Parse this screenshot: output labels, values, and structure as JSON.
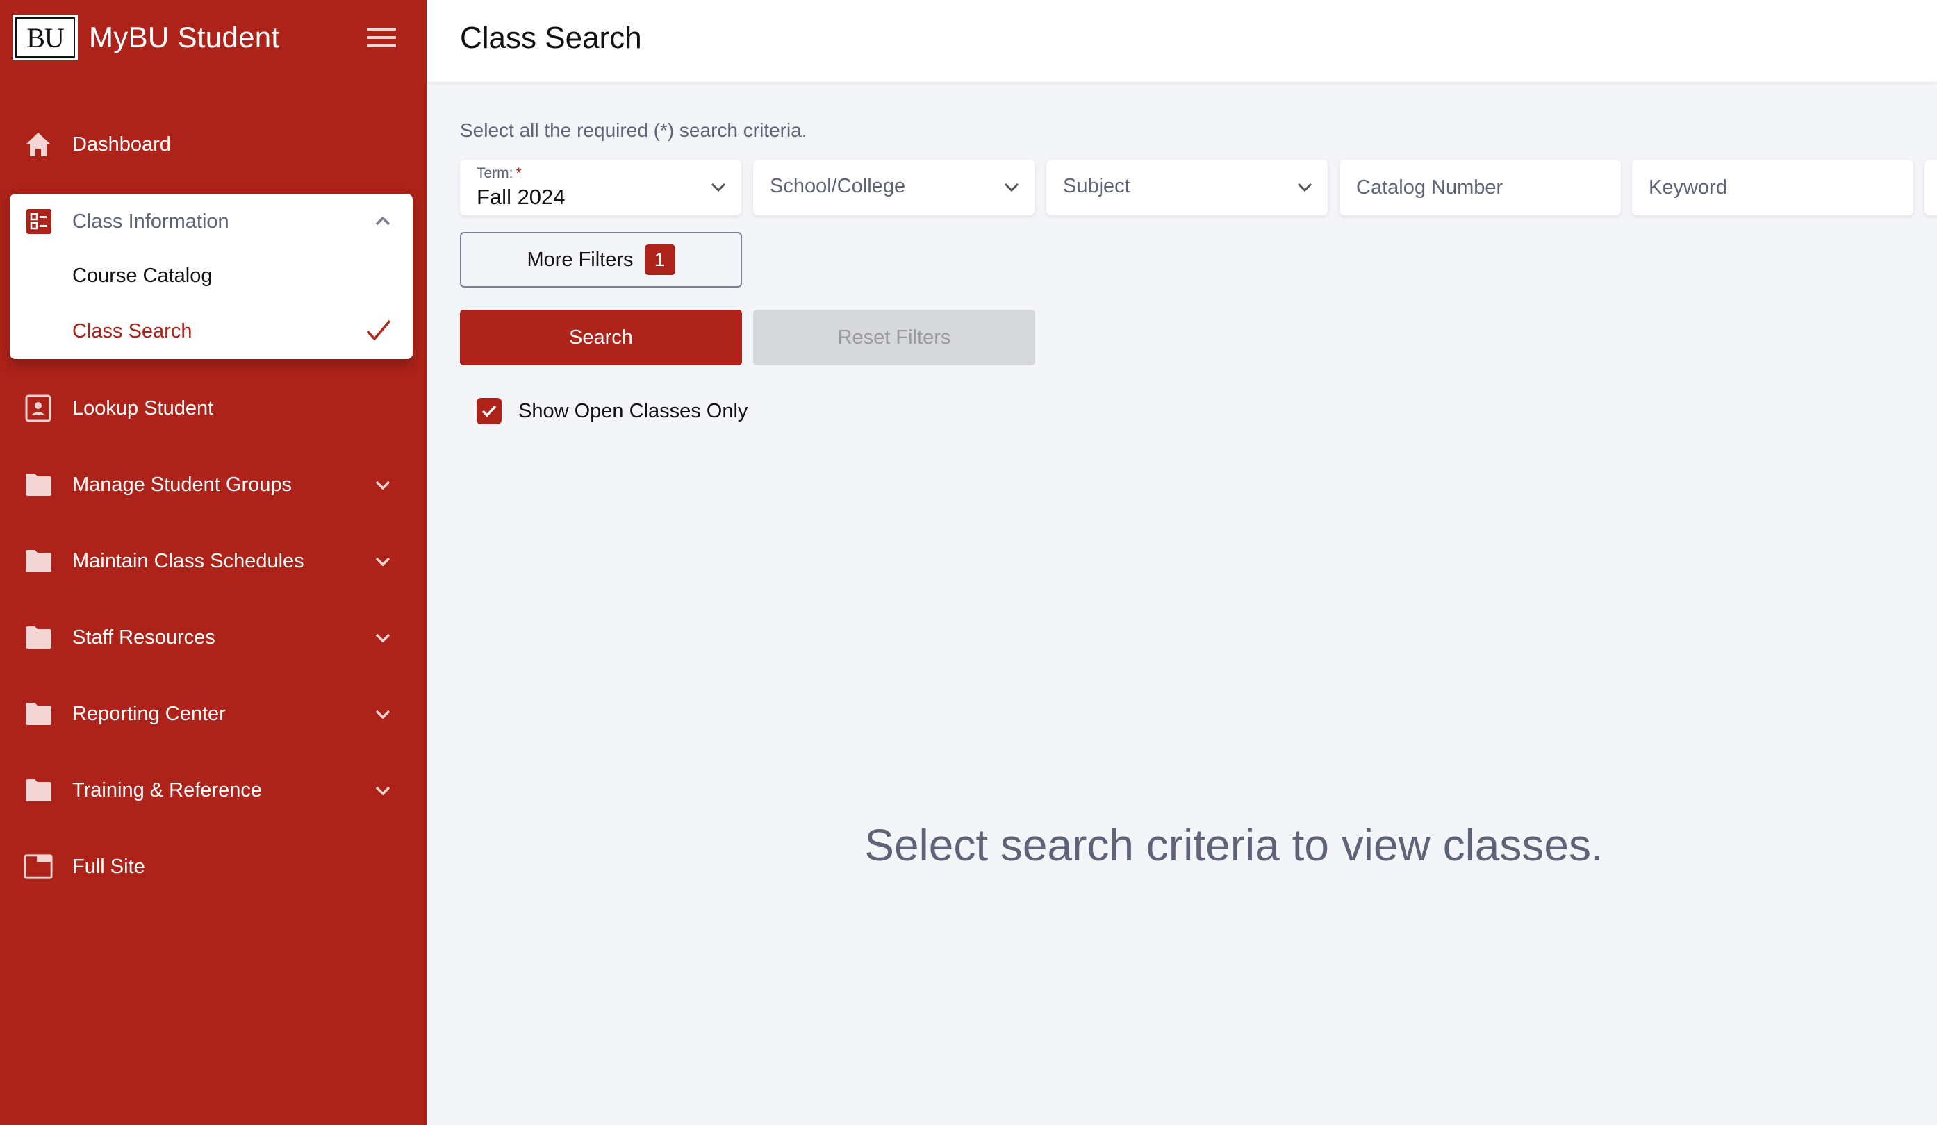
{
  "app": {
    "logo_text": "BU",
    "name": "MyBU Student",
    "accent_color": "#AD2219"
  },
  "sidebar": {
    "menu_icon": "hamburger-menu-icon",
    "items": [
      {
        "label": "Dashboard",
        "icon": "home-icon"
      },
      {
        "label": "Class Information",
        "icon": "checklist-icon",
        "expanded": true,
        "children": [
          {
            "label": "Course Catalog",
            "active": false
          },
          {
            "label": "Class Search",
            "active": true
          }
        ]
      },
      {
        "label": "Lookup Student",
        "icon": "contact-card-icon"
      },
      {
        "label": "Manage Student Groups",
        "icon": "folder-icon",
        "expandable": true
      },
      {
        "label": "Maintain Class Schedules",
        "icon": "folder-icon",
        "expandable": true
      },
      {
        "label": "Staff Resources",
        "icon": "folder-icon",
        "expandable": true
      },
      {
        "label": "Reporting Center",
        "icon": "folder-icon",
        "expandable": true
      },
      {
        "label": "Training & Reference",
        "icon": "folder-icon",
        "expandable": true
      },
      {
        "label": "Full Site",
        "icon": "window-icon"
      }
    ]
  },
  "header": {
    "title": "Class Search"
  },
  "search": {
    "hint": "Select all the required (*) search criteria.",
    "term": {
      "label": "Term:",
      "required_marker": "*",
      "value": "Fall 2024"
    },
    "school_college": {
      "placeholder": "School/College"
    },
    "subject": {
      "placeholder": "Subject"
    },
    "catalog_number": {
      "placeholder": "Catalog Number",
      "value": ""
    },
    "keyword": {
      "placeholder": "Keyword",
      "value": ""
    },
    "more_filters": {
      "label": "More Filters",
      "count": "1"
    },
    "search_button": "Search",
    "reset_button": "Reset Filters",
    "open_only": {
      "label": "Show Open Classes Only",
      "checked": true
    }
  },
  "empty_state": {
    "message": "Select search criteria to view classes."
  }
}
